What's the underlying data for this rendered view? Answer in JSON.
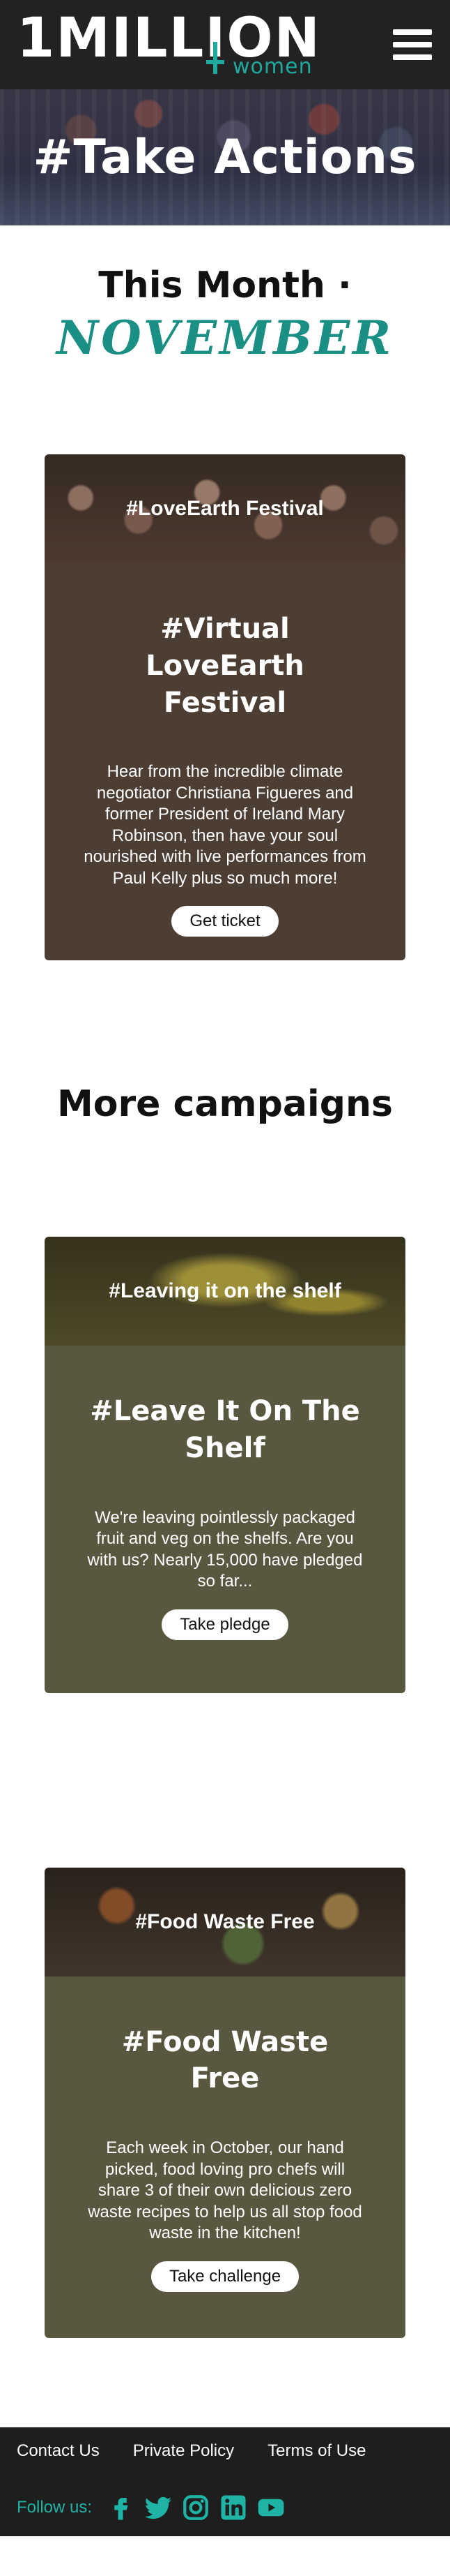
{
  "header": {
    "logo_text": "1MILLION",
    "logo_sub": "women",
    "menu_icon": "hamburger-menu-icon"
  },
  "hero": {
    "title": "#Take Actions"
  },
  "month": {
    "label": "This Month ·",
    "name": "NOVEMBER"
  },
  "featured": {
    "banner_label": "#LoveEarth Festival",
    "title": "#Virtual LoveEarth Festival",
    "description": "Hear from the incredible climate negotiator Christiana Figueres and former President of Ireland Mary Robinson, then have your soul nourished with live performances from Paul Kelly plus so much more!",
    "button": "Get ticket"
  },
  "more_campaigns": {
    "title": "More campaigns"
  },
  "campaigns": [
    {
      "banner_label": "#Leaving it on the shelf",
      "title": "#Leave It On The Shelf",
      "description": "We're leaving pointlessly packaged fruit and veg on the shelfs. Are you with us? Nearly 15,000 have pledged so far...",
      "button": "Take pledge"
    },
    {
      "banner_label": "#Food Waste Free",
      "title": "#Food Waste Free",
      "description": "Each week in October, our hand picked, food loving pro chefs will share 3 of their own delicious zero waste recipes to help us all stop food waste in the kitchen!",
      "button": "Take challenge"
    }
  ],
  "footer": {
    "links": [
      "Contact Us",
      "Private Policy",
      "Terms of Use"
    ],
    "follow_label": "Follow us:",
    "social_icons": [
      "facebook-icon",
      "twitter-icon",
      "instagram-icon",
      "linkedin-icon",
      "youtube-icon"
    ]
  },
  "colors": {
    "header_bg": "#222222",
    "accent_teal": "#1a8f84",
    "featured_card_bg": "#4d3e34",
    "campaign_card_bg": "#5a5740",
    "footer_bg": "#1e1e1e"
  }
}
